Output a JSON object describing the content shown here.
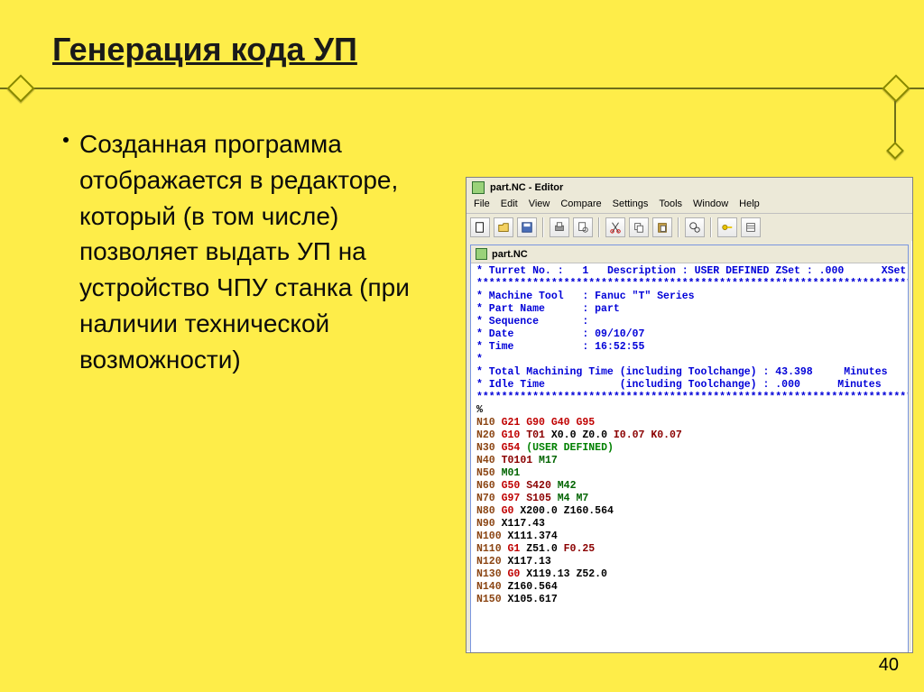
{
  "slide": {
    "title": "Генерация кода УП",
    "bullet_text": "Созданная программа отображается в редакторе, который (в том числе) позволяет выдать УП на устройство ЧПУ станка (при наличии технической возможности)",
    "page_num": "40"
  },
  "editor": {
    "title": "part.NC - Editor",
    "menu": [
      "File",
      "Edit",
      "View",
      "Compare",
      "Settings",
      "Tools",
      "Window",
      "Help"
    ],
    "tab_name": "part.NC",
    "header": {
      "turret_label": "* Turret No. :",
      "turret_val": "1",
      "desc_label": "Description :",
      "desc_val": "USER DEFINED",
      "zset_label": "ZSet :",
      "zset_val": ".000",
      "xset_label": "XSet :",
      "stars": "*************************************************************************",
      "mtool_label": "* Machine Tool",
      "mtool_val": ": Fanuc \"T\" Series",
      "pname_label": "* Part Name",
      "pname_val": ": part",
      "seq_label": "* Sequence",
      "seq_val": ":",
      "date_label": "* Date",
      "date_val": ": 09/10/07",
      "time_label": "* Time",
      "time_val": ": 16:52:55",
      "star_line": "*",
      "totm_label": "* Total Machining Time (including Toolchange) :",
      "totm_val": "43.398",
      "totm_unit": "Minutes",
      "idle_label": "* Idle Time            (including Toolchange) :",
      "idle_val": ".000",
      "idle_unit": "Minutes",
      "percent": "%"
    },
    "code": {
      "n10": {
        "n": "N10",
        "g1": "G21",
        "g2": "G90",
        "g3": "G40",
        "g4": "G95"
      },
      "n20": {
        "n": "N20",
        "g1": "G10",
        "t": "T01",
        "x": "X0.0",
        "z": "Z0.0",
        "i": "I0.07",
        "k": "K0.07"
      },
      "n30": {
        "n": "N30",
        "g1": "G54",
        "comment": "(USER DEFINED)"
      },
      "n40": {
        "n": "N40",
        "t": "T0101",
        "m": "M17"
      },
      "n50": {
        "n": "N50",
        "m": "M01"
      },
      "n60": {
        "n": "N60",
        "g1": "G50",
        "s": "S420",
        "m": "M42"
      },
      "n70": {
        "n": "N70",
        "g1": "G97",
        "s": "S105",
        "m1": "M4",
        "m2": "M7"
      },
      "n80": {
        "n": "N80",
        "g1": "G0",
        "x": "X200.0",
        "z": "Z160.564"
      },
      "n90": {
        "n": "N90",
        "x": "X117.43"
      },
      "n100": {
        "n": "N100",
        "x": "X111.374"
      },
      "n110": {
        "n": "N110",
        "g1": "G1",
        "z": "Z51.0",
        "f": "F0.25"
      },
      "n120": {
        "n": "N120",
        "x": "X117.13"
      },
      "n130": {
        "n": "N130",
        "g1": "G0",
        "x": "X119.13",
        "z": "Z52.0"
      },
      "n140": {
        "n": "N140",
        "z": "Z160.564"
      },
      "n150": {
        "n": "N150",
        "x": "X105.617"
      }
    },
    "toolbar_icons": [
      "new-icon",
      "open-icon",
      "save-icon",
      "print-icon",
      "preview-icon",
      "cut-icon",
      "copy-icon",
      "paste-icon",
      "find-icon",
      "key-icon",
      "settings-icon"
    ]
  }
}
